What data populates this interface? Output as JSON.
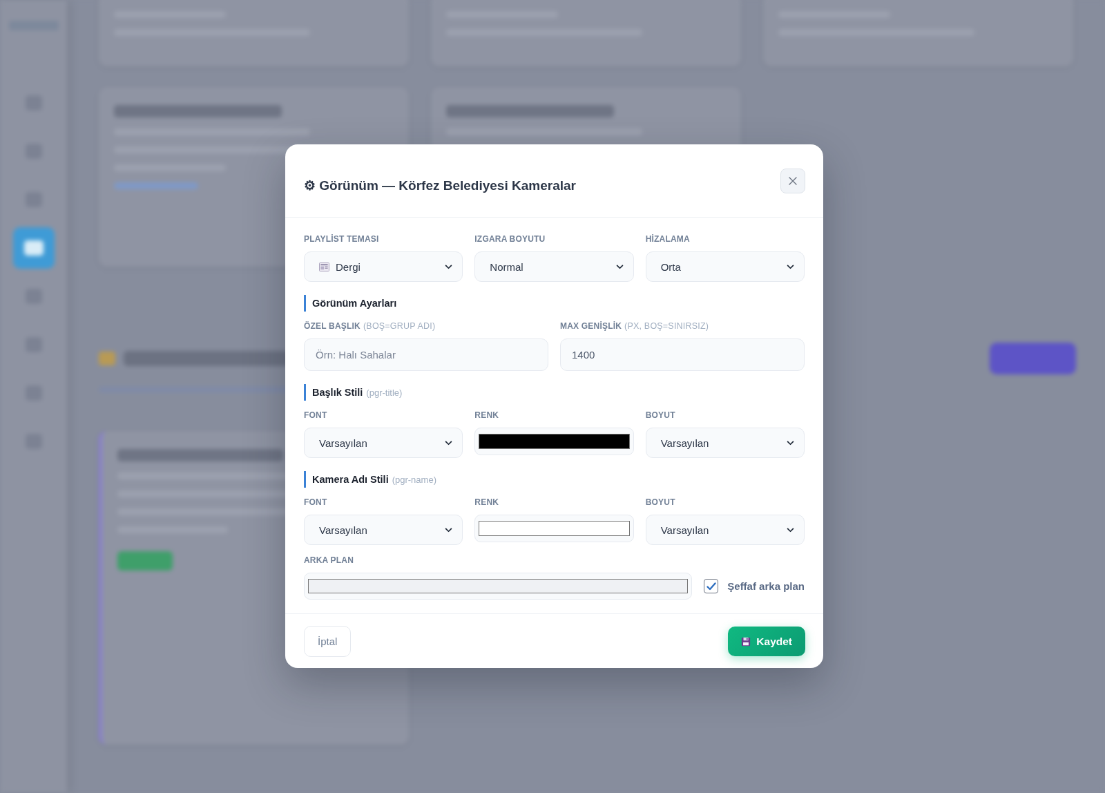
{
  "dialog": {
    "title": "⚙ Görünüm — Körfez Belediyesi Kameralar"
  },
  "theme_row": [
    {
      "label": "PLAYLİST TEMASI",
      "value": "Dergi",
      "icon": true
    },
    {
      "label": "IZGARA BOYUTU",
      "value": "Normal",
      "icon": false
    },
    {
      "label": "HİZALAMA",
      "value": "Orta",
      "icon": false
    }
  ],
  "sections": [
    {
      "title": "Görünüm Ayarları",
      "fields": [
        {
          "kind": "text",
          "label": "ÖZEL BAŞLIK",
          "hint": "(BOŞ=GRUP ADI)",
          "placeholder": "Örn: Halı Sahalar"
        },
        {
          "kind": "text",
          "label": "MAX GENİŞLİK",
          "hint": "(PX, BOŞ=SINIRSIZ)",
          "value": "1400"
        }
      ]
    },
    {
      "title": "Başlık Stili",
      "hint": "(pgr-title)",
      "fields": [
        {
          "kind": "select",
          "label": "FONT",
          "value": "Varsayılan"
        },
        {
          "kind": "color",
          "label": "RENK",
          "color": "#000000"
        },
        {
          "kind": "select",
          "label": "BOYUT",
          "value": "Varsayılan"
        }
      ]
    },
    {
      "title": "Kamera Adı Stili",
      "hint": "(pgr-name)",
      "fields": [
        {
          "kind": "select",
          "label": "FONT",
          "value": "Varsayılan"
        },
        {
          "kind": "color",
          "label": "RENK",
          "color": "#ffffff"
        },
        {
          "kind": "select",
          "label": "BOYUT",
          "value": "Varsayılan"
        }
      ]
    }
  ],
  "background": {
    "label": "ARKA PLAN",
    "color": "#eff1f4",
    "transparent": {
      "label": "Şeffaf arka plan",
      "checked": true
    }
  },
  "footer": {
    "cancel": "İptal",
    "save": "Kaydet"
  }
}
